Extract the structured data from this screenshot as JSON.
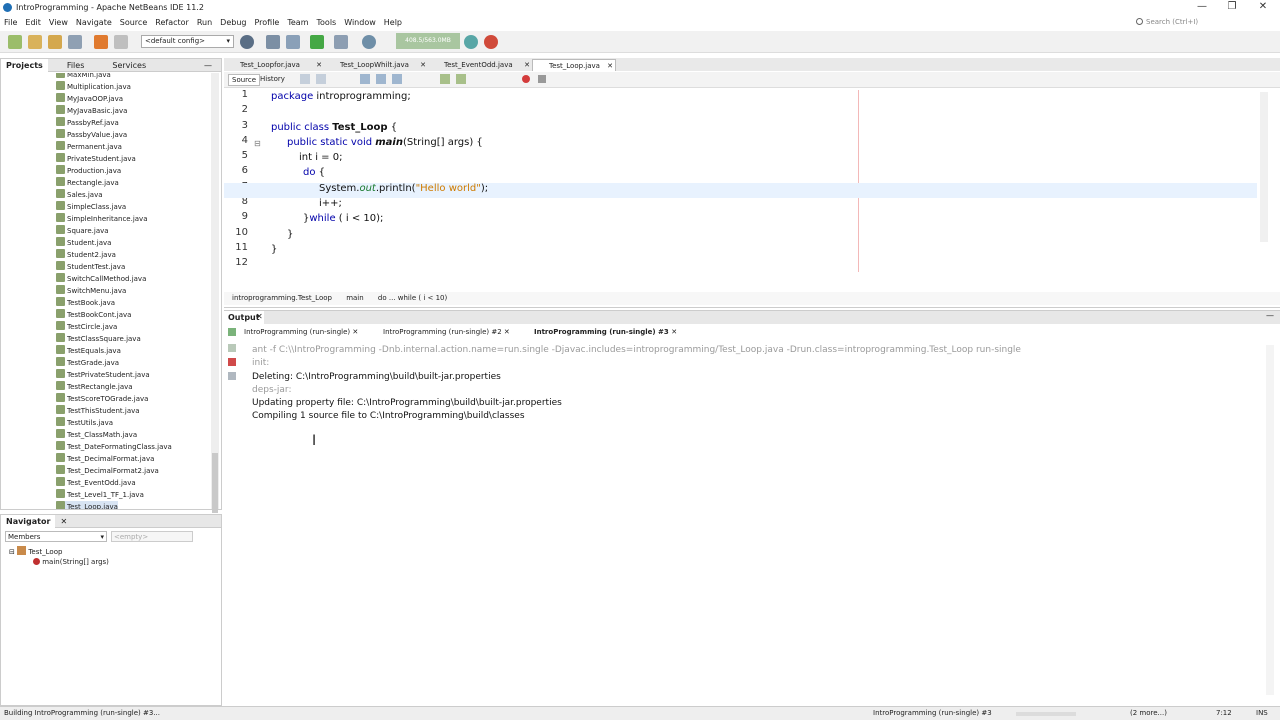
{
  "window": {
    "title": "IntroProgramming - Apache NetBeans IDE 11.2",
    "minimize": "—",
    "restore": "❐",
    "close": "✕"
  },
  "menu": [
    "File",
    "Edit",
    "View",
    "Navigate",
    "Source",
    "Refactor",
    "Run",
    "Debug",
    "Profile",
    "Team",
    "Tools",
    "Window",
    "Help"
  ],
  "search": {
    "placeholder": "Search (Ctrl+I)"
  },
  "toolbar": {
    "config": "<default config>",
    "memory": "408.5/563.0MB"
  },
  "left_panel": {
    "tabs": [
      "Projects",
      "Files",
      "Services"
    ],
    "files": [
      "MaxMin.java",
      "Multiplication.java",
      "MyJavaOOP.java",
      "MyJavaBasic.java",
      "PassbyRef.java",
      "PassbyValue.java",
      "Permanent.java",
      "PrivateStudent.java",
      "Production.java",
      "Rectangle.java",
      "Sales.java",
      "SimpleClass.java",
      "SimpleInheritance.java",
      "Square.java",
      "Student.java",
      "Student2.java",
      "StudentTest.java",
      "SwitchCallMethod.java",
      "SwitchMenu.java",
      "TestBook.java",
      "TestBookCont.java",
      "TestCircle.java",
      "TestClassSquare.java",
      "TestEquals.java",
      "TestGrade.java",
      "TestPrivateStudent.java",
      "TestRectangle.java",
      "TestScoreTOGrade.java",
      "TestThisStudent.java",
      "TestUtils.java",
      "Test_ClassMath.java",
      "Test_DateFormatingClass.java",
      "Test_DecimalFormat.java",
      "Test_DecimalFormat2.java",
      "Test_EventOdd.java",
      "Test_Level1_TF_1.java",
      "Test_Loop.java"
    ]
  },
  "navigator": {
    "title": "Navigator",
    "members": "Members",
    "filter": "<empty>",
    "class": "Test_Loop",
    "method": "main(String[] args)"
  },
  "editor": {
    "tabs": [
      "Test_Loopfor.java",
      "Test_LoopWhilt.java",
      "Test_EventOdd.java",
      "Test_Loop.java"
    ],
    "source_label": "Source",
    "history_label": "History",
    "line_numbers": [
      "1",
      "2",
      "3",
      "4",
      "5",
      "6",
      "7",
      "8",
      "9",
      "10",
      "11",
      "12"
    ],
    "code": {
      "l1_kw": "package",
      "l1_rest": " introprogramming;",
      "l3_kw": "public class",
      "l3_name": "Test_Loop",
      "l3_rest": " {",
      "l4_kw": "public static void",
      "l4_name": "main",
      "l4_rest": "(String[] args) {",
      "l5": "int i = 0;",
      "l6_kw": "do",
      "l6_rest": " {",
      "l7_a": "System.",
      "l7_out": "out",
      "l7_b": ".println(",
      "l7_str": "\"Hello world\"",
      "l7_c": ");",
      "l8": "i++;",
      "l9_a": "}",
      "l9_kw": "while",
      "l9_rest": " ( i < 10);",
      "l10": "}",
      "l11": "}"
    },
    "breadcrumb": [
      "introprogramming.Test_Loop",
      "main",
      "do ... while ( i < 10)"
    ]
  },
  "output": {
    "title": "Output",
    "tabs": [
      "IntroProgramming (run-single)",
      "IntroProgramming (run-single) #2",
      "IntroProgramming (run-single) #3"
    ],
    "lines": [
      "ant -f C:\\\\IntroProgramming -Dnb.internal.action.name=run.single -Djavac.includes=introprogramming/Test_Loop.java -Drun.class=introprogramming.Test_Loop run-single",
      "init:",
      "Deleting: C:\\IntroProgramming\\build\\built-jar.properties",
      "deps-jar:",
      "Updating property file: C:\\IntroProgramming\\build\\built-jar.properties",
      "Compiling 1 source file to C:\\IntroProgramming\\build\\classes"
    ]
  },
  "status": {
    "left": "Building IntroProgramming (run-single) #3...",
    "task": "IntroProgramming (run-single) #3",
    "more": "(2 more...)",
    "position": "7:12",
    "mode": "INS"
  }
}
